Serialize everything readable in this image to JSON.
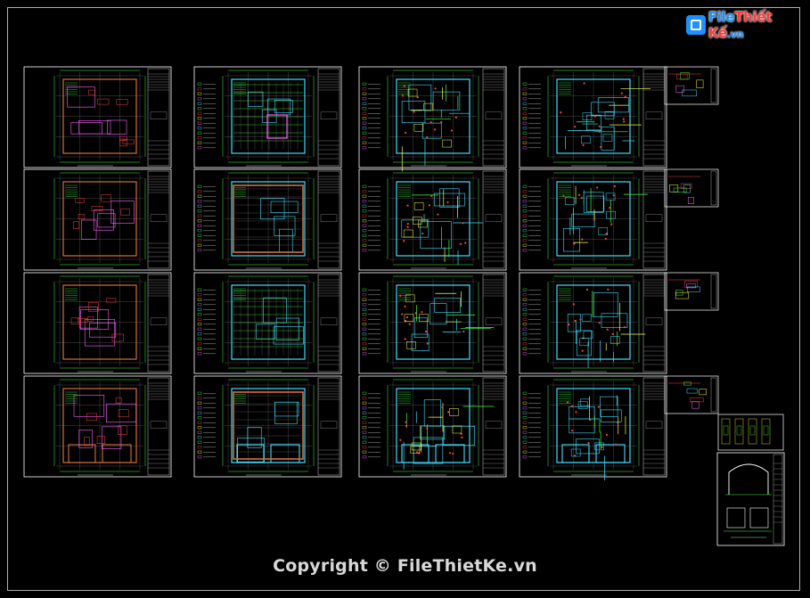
{
  "watermark": {
    "text": "Copyright © FileThietKe.vn"
  },
  "logo": {
    "part1": "File",
    "part2": "Thiết Kế",
    "part3": ".vn"
  },
  "colors": {
    "background": "#000000",
    "sheet_border": "#ffffff",
    "title_block": "#c8c8c8",
    "wall_magenta": "#ff60ff",
    "wall_brown": "#d2703a",
    "wall_cyan": "#40e0ff",
    "dim_green": "#40ff40",
    "furniture_red": "#ff4040",
    "electric_yellow": "#ffff40",
    "grid_gray": "#7a7a7a"
  },
  "icons": {
    "logo": "filethietke-logo-icon"
  }
}
